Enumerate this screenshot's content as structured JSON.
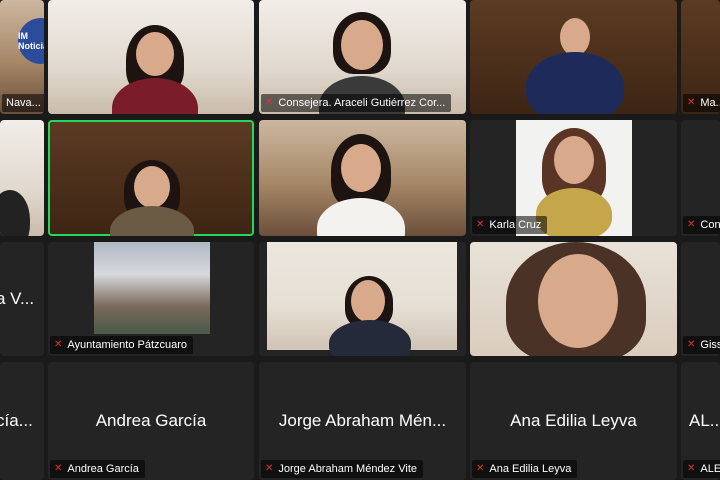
{
  "meeting": {
    "logo_text": "IM Noticias",
    "tiles": [
      {
        "label": "Nava..."
      },
      {
        "label": ""
      },
      {
        "label": "Consejera. Araceli Gutiérrez Cor..."
      },
      {
        "label": ""
      },
      {
        "label": "Ma..."
      },
      {
        "label": ""
      },
      {
        "label": ""
      },
      {
        "label": ""
      },
      {
        "label": "Karla Cruz"
      },
      {
        "label": "Con..."
      },
      {
        "big": "a V...",
        "label": ""
      },
      {
        "label": "Ayuntamiento Pátzcuaro"
      },
      {
        "label": ""
      },
      {
        "label": ""
      },
      {
        "label": "Giss..."
      },
      {
        "big": "cía...",
        "label": ""
      },
      {
        "big": "Andrea García",
        "label": "Andrea García"
      },
      {
        "big": "Jorge Abraham Mén...",
        "label": "Jorge Abraham Méndez Vite"
      },
      {
        "big": "Ana Edilia Leyva",
        "label": "Ana Edilia Leyva"
      },
      {
        "big": "AL...",
        "label": "ALE..."
      }
    ]
  }
}
